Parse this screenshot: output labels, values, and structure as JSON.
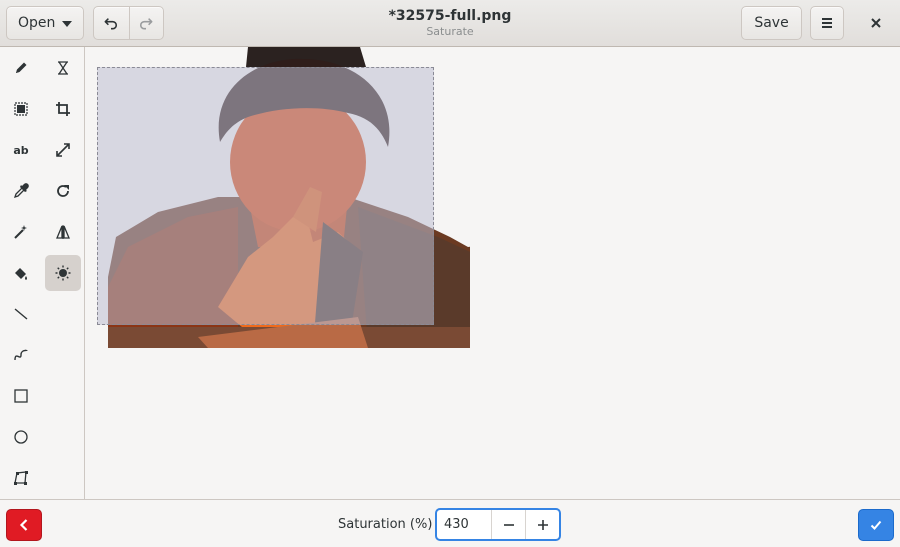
{
  "header": {
    "open_label": "Open",
    "title": "*32575-full.png",
    "subtitle": "Saturate",
    "save_label": "Save"
  },
  "tools": [
    {
      "name": "pencil-tool",
      "icon": "pencil-icon"
    },
    {
      "name": "highlighter-tool",
      "icon": "highlighter-icon"
    },
    {
      "name": "selection-tool",
      "icon": "rectangle-select-icon"
    },
    {
      "name": "crop-tool",
      "icon": "crop-icon"
    },
    {
      "name": "text-tool",
      "icon": "text-icon",
      "label": "ab"
    },
    {
      "name": "scale-tool",
      "icon": "scale-icon"
    },
    {
      "name": "color-picker-tool",
      "icon": "eyedropper-icon"
    },
    {
      "name": "rotate-tool",
      "icon": "rotate-icon"
    },
    {
      "name": "filters-tool",
      "icon": "magic-wand-icon"
    },
    {
      "name": "flip-tool",
      "icon": "flip-icon"
    },
    {
      "name": "paint-tool",
      "icon": "paint-bucket-icon"
    },
    {
      "name": "saturate-tool",
      "icon": "brightness-icon",
      "active": true
    },
    {
      "name": "line-tool",
      "icon": "line-icon"
    },
    {
      "name": "curve-tool",
      "icon": "curve-icon"
    },
    {
      "name": "rectangle-tool",
      "icon": "rectangle-icon"
    },
    {
      "name": "circle-tool",
      "icon": "circle-icon"
    },
    {
      "name": "freeshape-tool",
      "icon": "freeshape-icon"
    }
  ],
  "bottom": {
    "saturation_label": "Saturation (%)",
    "saturation_value": "430"
  },
  "colors": {
    "accent": "#3584e4",
    "destructive": "#e01b24",
    "selection_overlay": "#bebed2"
  }
}
